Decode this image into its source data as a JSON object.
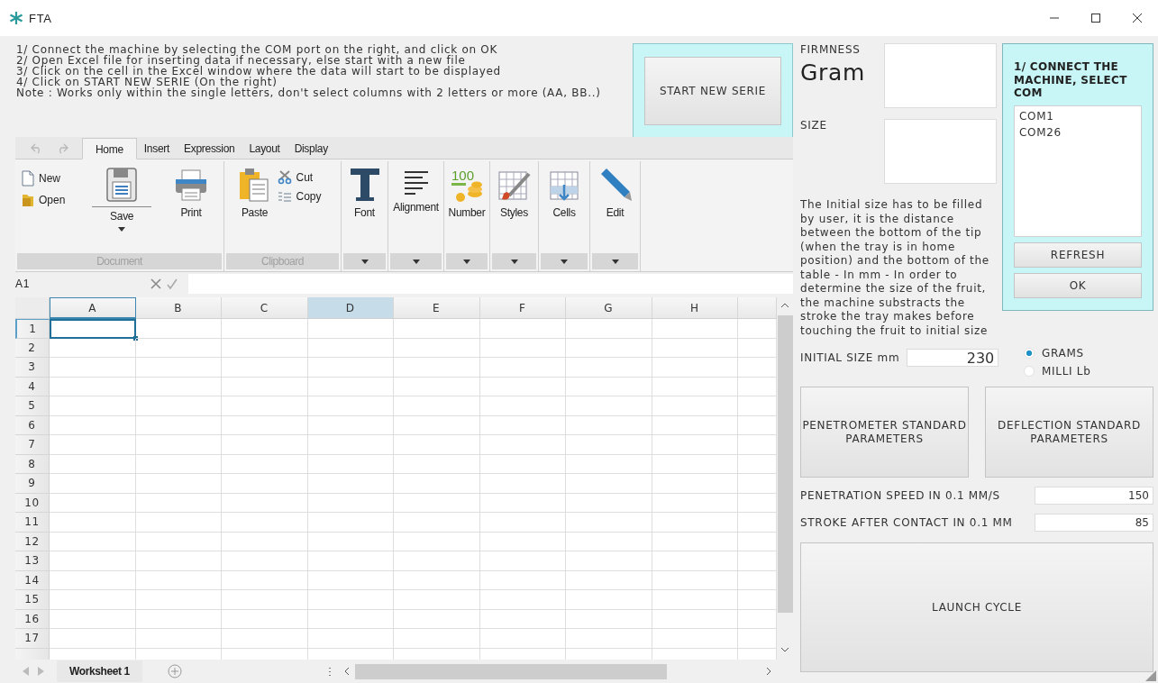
{
  "window": {
    "title": "FTA"
  },
  "instructions": [
    "1/ Connect the machine by selecting the COM port on the right, and click on OK",
    "2/ Open Excel file for inserting data if necessary, else start with a new file",
    "3/ Click on the cell in the Excel window where the data will start to be displayed",
    "4/ Click on START NEW SERIE (On the right)",
    "Note : Works only within the single letters, don't select columns with 2 letters or more (AA, BB..)"
  ],
  "start_button": "START NEW SERIE",
  "ribbon": {
    "tabs": [
      {
        "label": "Home",
        "selected": true
      },
      {
        "label": "Insert",
        "selected": false
      },
      {
        "label": "Expression",
        "selected": false
      },
      {
        "label": "Layout",
        "selected": false
      },
      {
        "label": "Display",
        "selected": false
      }
    ],
    "groups": [
      {
        "label": "Document",
        "items": [
          {
            "kind": "small",
            "label": "New"
          },
          {
            "kind": "small",
            "label": "Open"
          },
          {
            "kind": "split",
            "label": "Save"
          },
          {
            "kind": "large",
            "label": "Print"
          }
        ]
      },
      {
        "label": "Clipboard",
        "items": [
          {
            "kind": "large",
            "label": "Paste"
          },
          {
            "kind": "small",
            "label": "Cut"
          },
          {
            "kind": "small",
            "label": "Copy"
          }
        ]
      },
      {
        "dropdown": true,
        "items": [
          {
            "kind": "large",
            "label": "Font"
          }
        ]
      },
      {
        "dropdown": true,
        "items": [
          {
            "kind": "large",
            "label": "Alignment"
          }
        ]
      },
      {
        "dropdown": true,
        "items": [
          {
            "kind": "large",
            "label": "Number",
            "icon_text": "100"
          }
        ]
      },
      {
        "dropdown": true,
        "items": [
          {
            "kind": "large",
            "label": "Styles"
          }
        ]
      },
      {
        "dropdown": true,
        "items": [
          {
            "kind": "large",
            "label": "Cells"
          }
        ]
      },
      {
        "dropdown": true,
        "items": [
          {
            "kind": "large",
            "label": "Edit"
          }
        ]
      }
    ]
  },
  "formula_bar": {
    "cell_ref": "A1"
  },
  "sheet": {
    "columns": [
      {
        "label": "A",
        "active": true,
        "highlighted": false
      },
      {
        "label": "B",
        "active": false,
        "highlighted": false
      },
      {
        "label": "C",
        "active": false,
        "highlighted": false
      },
      {
        "label": "D",
        "active": false,
        "highlighted": true
      },
      {
        "label": "E",
        "active": false,
        "highlighted": false
      },
      {
        "label": "F",
        "active": false,
        "highlighted": false
      },
      {
        "label": "G",
        "active": false,
        "highlighted": false
      },
      {
        "label": "H",
        "active": false,
        "highlighted": false
      }
    ],
    "rows": [
      {
        "label": "1",
        "active": true
      },
      {
        "label": "2",
        "active": false
      },
      {
        "label": "3",
        "active": false
      },
      {
        "label": "4",
        "active": false
      },
      {
        "label": "5",
        "active": false
      },
      {
        "label": "6",
        "active": false
      },
      {
        "label": "7",
        "active": false
      },
      {
        "label": "8",
        "active": false
      },
      {
        "label": "9",
        "active": false
      },
      {
        "label": "10",
        "active": false
      },
      {
        "label": "11",
        "active": false
      },
      {
        "label": "12",
        "active": false
      },
      {
        "label": "13",
        "active": false
      },
      {
        "label": "14",
        "active": false
      },
      {
        "label": "15",
        "active": false
      },
      {
        "label": "16",
        "active": false
      },
      {
        "label": "17",
        "active": false
      }
    ],
    "tabs": [
      {
        "label": "Worksheet 1",
        "selected": true
      }
    ]
  },
  "measure": {
    "firmness_label": "FIRMNESS",
    "unit": "Gram",
    "size_label": "SIZE",
    "note": "The Initial size has to be filled by user, it is the distance between the bottom of the tip (when the tray is in home position) and the bottom of the table - In mm - In order to determine the size of the fruit, the machine substracts the stroke the tray makes before touching the fruit to initial size",
    "initial_size_label": "INITIAL SIZE mm",
    "initial_size": "230"
  },
  "connect": {
    "title": "1/ CONNECT THE MACHINE, SELECT COM",
    "ports": [
      {
        "label": "COM1",
        "selected": false
      },
      {
        "label": "COM26",
        "selected": false
      }
    ],
    "buttons": [
      "REFRESH",
      "OK"
    ]
  },
  "units": [
    {
      "label": "GRAMS",
      "selected": true
    },
    {
      "label": "MILLI Lb",
      "selected": false
    }
  ],
  "param_buttons": [
    "PENETROMETER STANDARD PARAMETERS",
    "DEFLECTION STANDARD PARAMETERS"
  ],
  "settings": [
    {
      "label": "PENETRATION SPEED IN 0.1 MM/S",
      "value": "150"
    },
    {
      "label": "STROKE AFTER CONTACT IN 0.1 MM",
      "value": "85"
    }
  ],
  "launch_button": "LAUNCH CYCLE"
}
